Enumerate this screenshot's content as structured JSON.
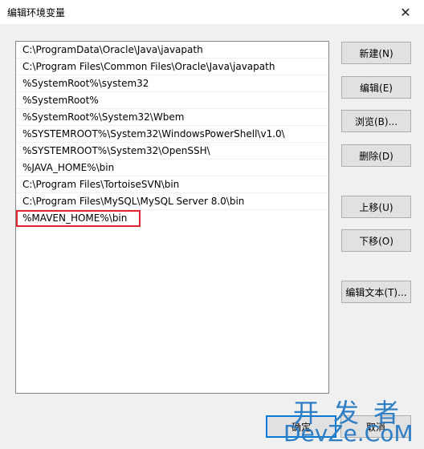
{
  "window": {
    "title": "编辑环境变量",
    "close_glyph": "✕"
  },
  "paths": [
    "C:\\ProgramData\\Oracle\\Java\\javapath",
    "C:\\Program Files\\Common Files\\Oracle\\Java\\javapath",
    "%SystemRoot%\\system32",
    "%SystemRoot%",
    "%SystemRoot%\\System32\\Wbem",
    "%SYSTEMROOT%\\System32\\WindowsPowerShell\\v1.0\\",
    "%SYSTEMROOT%\\System32\\OpenSSH\\",
    "%JAVA_HOME%\\bin",
    "C:\\Program Files\\TortoiseSVN\\bin",
    "C:\\Program Files\\MySQL\\MySQL Server 8.0\\bin",
    "%MAVEN_HOME%\\bin"
  ],
  "buttons": {
    "new": "新建(N)",
    "edit": "编辑(E)",
    "browse": "浏览(B)...",
    "delete": "删除(D)",
    "move_up": "上移(U)",
    "move_down": "下移(O)",
    "edit_text": "编辑文本(T)...",
    "ok": "确定",
    "cancel": "取消"
  },
  "watermark": {
    "cn": "开发者",
    "en": "DevZe.CoM"
  },
  "colors": {
    "highlight_box": "#e0262c",
    "watermark": "#2d7ec4"
  }
}
